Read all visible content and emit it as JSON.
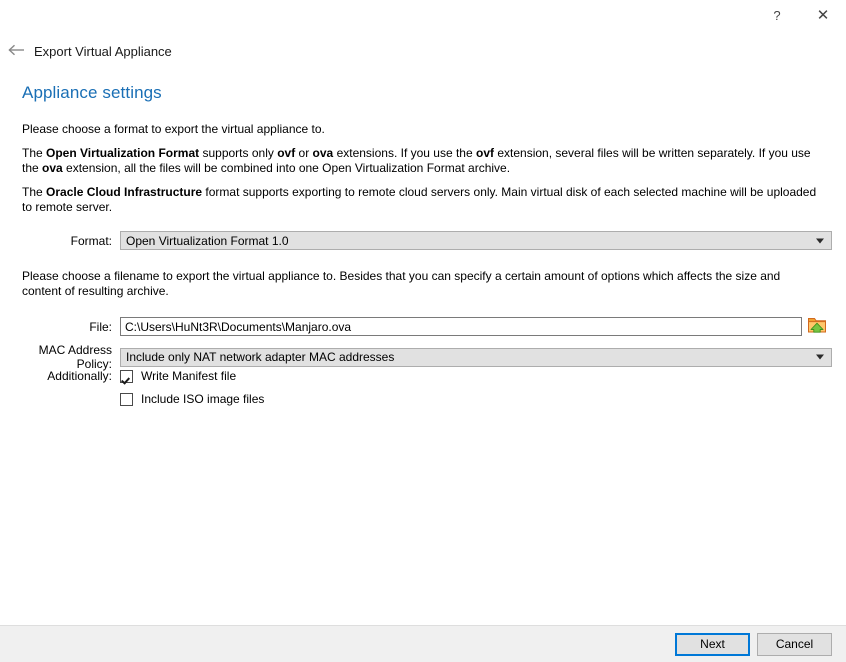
{
  "window": {
    "help_icon": "question-mark-icon",
    "close_icon": "close-icon",
    "help_label": "?",
    "close_label": "✕"
  },
  "header": {
    "back_icon": "back-arrow-icon",
    "wizard_title": "Export Virtual Appliance",
    "page_title": "Appliance settings",
    "page_title_color": "#1a6fb5"
  },
  "body": {
    "para1": "Please choose a format to export the virtual appliance to.",
    "para2_segments": [
      {
        "text": "The ",
        "bold": false
      },
      {
        "text": "Open Virtualization Format",
        "bold": true
      },
      {
        "text": " supports only ",
        "bold": false
      },
      {
        "text": "ovf",
        "bold": true
      },
      {
        "text": " or ",
        "bold": false
      },
      {
        "text": "ova",
        "bold": true
      },
      {
        "text": " extensions. If you use the ",
        "bold": false
      },
      {
        "text": "ovf",
        "bold": true
      },
      {
        "text": " extension, several files will be written separately. If you use the ",
        "bold": false
      },
      {
        "text": "ova",
        "bold": true
      },
      {
        "text": " extension, all the files will be combined into one Open Virtualization Format archive.",
        "bold": false
      }
    ],
    "para3_segments": [
      {
        "text": "The ",
        "bold": false
      },
      {
        "text": "Oracle Cloud Infrastructure",
        "bold": true
      },
      {
        "text": " format supports exporting to remote cloud servers only. Main virtual disk of each selected machine will be uploaded to remote server.",
        "bold": false
      }
    ],
    "para4": "Please choose a filename to export the virtual appliance to. Besides that you can specify a certain amount of options which affects the size and content of resulting archive."
  },
  "form": {
    "format": {
      "label": "Format:",
      "value": "Open Virtualization Format 1.0",
      "caret_icon": "chevron-down-icon"
    },
    "file": {
      "label": "File:",
      "value": "C:\\Users\\HuNt3R\\Documents\\Manjaro.ova",
      "placeholder": "C:\\Users\\HuNt3R\\Documents\\Manjaro.ova",
      "browse_icon": "folder-open-icon"
    },
    "mac_policy": {
      "label": "MAC Address Policy:",
      "value": "Include only NAT network adapter MAC addresses",
      "caret_icon": "chevron-down-icon"
    },
    "additionally": {
      "label": "Additionally:",
      "checkbox1": {
        "label": "Write Manifest file",
        "checked": true
      },
      "checkbox2": {
        "label": "Include ISO image files",
        "checked": false
      }
    }
  },
  "footer": {
    "next_label": "Next",
    "cancel_label": "Cancel",
    "accent_color": "#0078d7"
  }
}
